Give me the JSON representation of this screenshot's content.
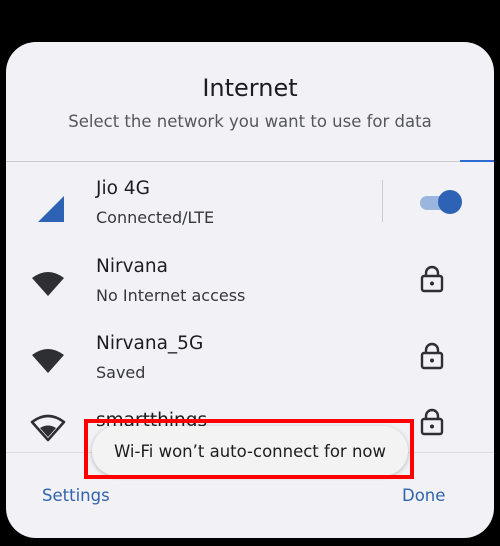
{
  "dialog": {
    "title": "Internet",
    "subtitle": "Select the network you want to use for data"
  },
  "networks": [
    {
      "name": "Jio 4G",
      "status": "Connected/LTE",
      "icon": "cellular-signal-icon",
      "toggle_on": true
    },
    {
      "name": "Nirvana",
      "status": "No Internet access",
      "icon": "wifi-icon",
      "locked": true
    },
    {
      "name": "Nirvana_5G",
      "status": "Saved",
      "icon": "wifi-icon",
      "locked": true
    },
    {
      "name": "smartthings",
      "status": "",
      "icon": "wifi-outline-icon",
      "locked": true
    }
  ],
  "footer": {
    "settings_label": "Settings",
    "done_label": "Done"
  },
  "toast": {
    "message": "Wi-Fi won’t auto-connect for now"
  },
  "colors": {
    "accent": "#2d62b4",
    "link": "#2f63aa",
    "panel_bg": "#f2f2f6",
    "highlight": "#ff0000"
  }
}
